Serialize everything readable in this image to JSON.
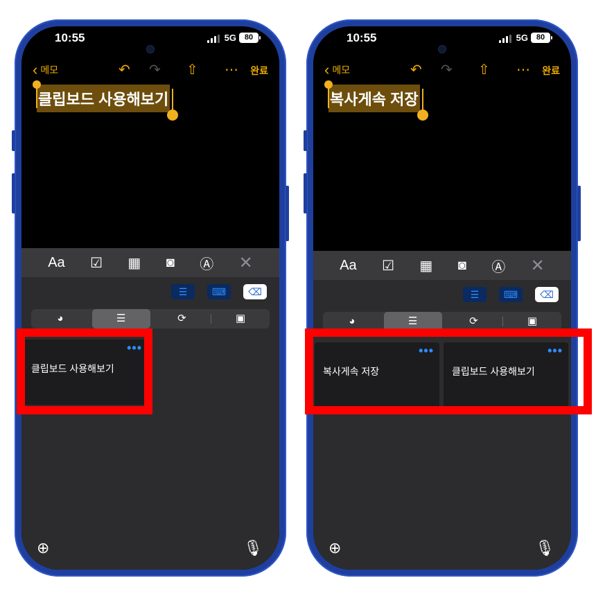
{
  "screens": [
    {
      "status": {
        "time": "10:55",
        "network": "5G",
        "battery": "80"
      },
      "nav": {
        "back_label": "메모",
        "back_chevron": "‹",
        "undo_icon": "↶",
        "redo_icon": "↷",
        "share_icon": "⇧",
        "more_icon": "⋯",
        "done_label": "완료"
      },
      "note_title": "클립보드 사용해보기",
      "toolbar": {
        "format_label": "Aa",
        "checklist_icon": "☑",
        "table_icon": "▦",
        "camera_icon": "◙",
        "markup_icon": "Ⓐ",
        "close_icon": "✕"
      },
      "clipboard_tools": {
        "list_icon": "☰",
        "keyboard_icon": "⌨",
        "delete_icon": "⌫"
      },
      "segments": [
        "recent",
        "list",
        "sync",
        "photos"
      ],
      "segment_icons": [
        "◕",
        "☰",
        "⟳",
        "▣"
      ],
      "cards": [
        {
          "text": "클립보드 사용해보기",
          "more": "•••"
        }
      ],
      "globe_icon": "⊕",
      "mic_icon": "🎙"
    },
    {
      "status": {
        "time": "10:55",
        "network": "5G",
        "battery": "80"
      },
      "nav": {
        "back_label": "메모",
        "back_chevron": "‹",
        "undo_icon": "↶",
        "redo_icon": "↷",
        "share_icon": "⇧",
        "more_icon": "⋯",
        "done_label": "완료"
      },
      "note_title": "복사게속 저장",
      "toolbar": {
        "format_label": "Aa",
        "checklist_icon": "☑",
        "table_icon": "▦",
        "camera_icon": "◙",
        "markup_icon": "Ⓐ",
        "close_icon": "✕"
      },
      "clipboard_tools": {
        "list_icon": "☰",
        "keyboard_icon": "⌨",
        "delete_icon": "⌫"
      },
      "segments": [
        "recent",
        "list",
        "sync",
        "photos"
      ],
      "segment_icons": [
        "◕",
        "☰",
        "⟳",
        "▣"
      ],
      "cards": [
        {
          "text": "복사게속 저장",
          "more": "•••"
        },
        {
          "text": "클립보드 사용해보기",
          "more": "•••"
        }
      ],
      "globe_icon": "⊕",
      "mic_icon": "🎙"
    }
  ],
  "highlight_color": "#ff0000",
  "accent_color": "#f0ad00"
}
